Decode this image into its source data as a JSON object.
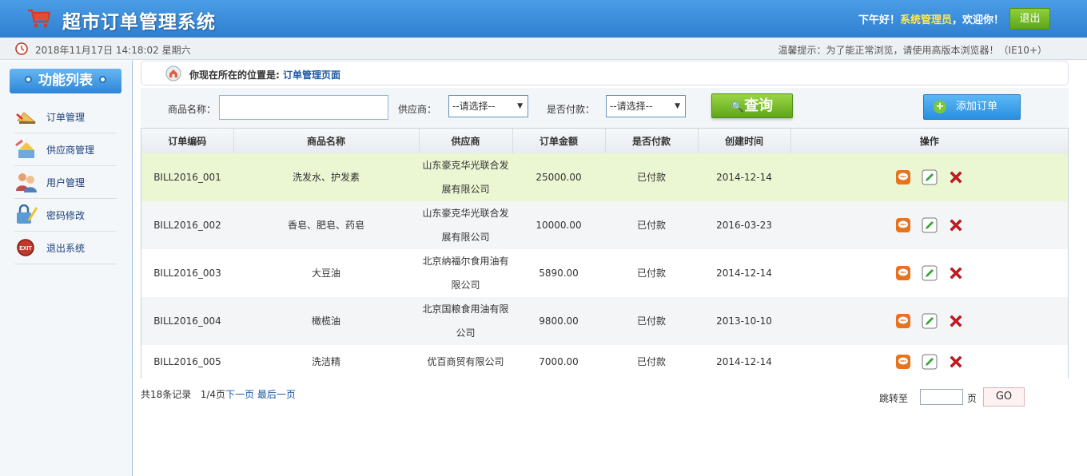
{
  "header": {
    "title": "超市订单管理系统",
    "greeting_prefix": "下午好！",
    "username": "系统管理员",
    "greeting_suffix": "，欢迎你！",
    "logout_label": "退出"
  },
  "subbar": {
    "datetime": "2018年11月17日 14:18:02 星期六",
    "tip": "温馨提示：为了能正常浏览，请使用高版本浏览器！（IE10+）"
  },
  "sidebar": {
    "title": "功能列表",
    "items": [
      {
        "label": "订单管理",
        "icon": "order-icon"
      },
      {
        "label": "供应商管理",
        "icon": "provider-icon"
      },
      {
        "label": "用户管理",
        "icon": "users-icon"
      },
      {
        "label": "密码修改",
        "icon": "password-icon"
      },
      {
        "label": "退出系统",
        "icon": "exit-icon"
      }
    ]
  },
  "breadcrumb": {
    "prefix": "你现在所在的位置是:",
    "location": "订单管理页面"
  },
  "search": {
    "product_label": "商品名称：",
    "product_value": "",
    "provider_label": "供应商：",
    "provider_selected": "--请选择--",
    "paid_label": "是否付款：",
    "paid_selected": "--请选择--",
    "query_label": "查询",
    "add_label": "添加订单"
  },
  "table": {
    "headers": [
      "订单编码",
      "商品名称",
      "供应商",
      "订单金额",
      "是否付款",
      "创建时间",
      "操作"
    ],
    "rows": [
      {
        "code": "BILL2016_001",
        "product": "洗发水、护发素",
        "provider_l1": "山东豪克华光联合发",
        "provider_l2": "展有限公司",
        "amount": "25000.00",
        "paid": "已付款",
        "created": "2014-12-14"
      },
      {
        "code": "BILL2016_002",
        "product": "香皂、肥皂、药皂",
        "provider_l1": "山东豪克华光联合发",
        "provider_l2": "展有限公司",
        "amount": "10000.00",
        "paid": "已付款",
        "created": "2016-03-23"
      },
      {
        "code": "BILL2016_003",
        "product": "大豆油",
        "provider_l1": "北京纳福尔食用油有",
        "provider_l2": "限公司",
        "amount": "5890.00",
        "paid": "已付款",
        "created": "2014-12-14"
      },
      {
        "code": "BILL2016_004",
        "product": "橄榄油",
        "provider_l1": "北京国粮食用油有限",
        "provider_l2": "公司",
        "amount": "9800.00",
        "paid": "已付款",
        "created": "2013-10-10"
      },
      {
        "code": "BILL2016_005",
        "product": "洗洁精",
        "provider_l1": "优百商贸有限公司",
        "provider_l2": "",
        "amount": "7000.00",
        "paid": "已付款",
        "created": "2014-12-14"
      }
    ]
  },
  "pager": {
    "total": "共18条记录",
    "page_info": "1/4页",
    "next": "下一页",
    "last": "最后一页",
    "jump_label": "跳转至",
    "jump_value": "",
    "page_unit": "页",
    "go_label": "GO"
  },
  "colors": {
    "header_blue": "#2f7fd0",
    "accent_green": "#5fa61b",
    "highlight_row": "#ebf6d2",
    "link_blue": "#1c5aa8"
  }
}
